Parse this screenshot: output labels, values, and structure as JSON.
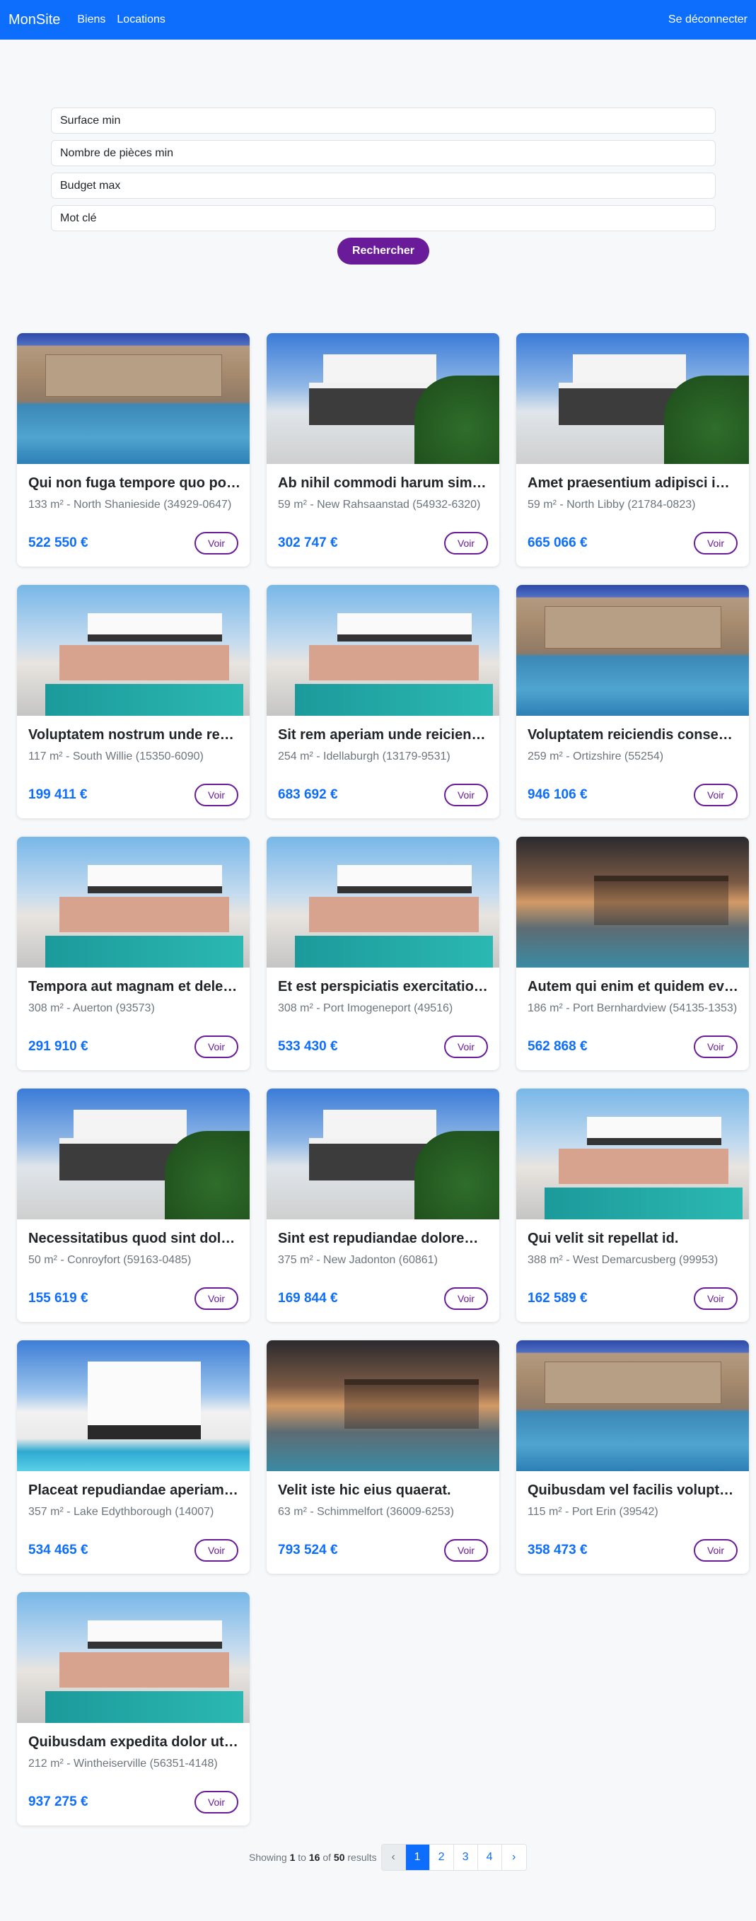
{
  "nav": {
    "brand": "MonSite",
    "links": [
      "Biens",
      "Locations"
    ],
    "logout": "Se déconnecter"
  },
  "search": {
    "surface_placeholder": "Surface min",
    "rooms_placeholder": "Nombre de pièces min",
    "budget_placeholder": "Budget max",
    "keyword_placeholder": "Mot clé",
    "button": "Rechercher"
  },
  "listings": [
    {
      "title": "Qui non fuga tempore quo possimus",
      "subtitle": "133 m² - North Shanieside (34929-0647)",
      "price": "522 550 €",
      "image": "pool-stone-house"
    },
    {
      "title": "Ab nihil commodi harum similique",
      "subtitle": "59 m² - New Rahsaanstad (54932-6320)",
      "price": "302 747 €",
      "image": "modern-white-villa"
    },
    {
      "title": "Amet praesentium adipisci impedit",
      "subtitle": "59 m² - North Libby (21784-0823)",
      "price": "665 066 €",
      "image": "modern-white-villa"
    },
    {
      "title": "Voluptatem nostrum unde repellat",
      "subtitle": "117 m² - South Willie (15350-6090)",
      "price": "199 411 €",
      "image": "pink-villa-pool"
    },
    {
      "title": "Sit rem aperiam unde reiciendis",
      "subtitle": "254 m² - Idellaburgh (13179-9531)",
      "price": "683 692 €",
      "image": "pink-villa-pool"
    },
    {
      "title": "Voluptatem reiciendis consequatur",
      "subtitle": "259 m² - Ortizshire (55254)",
      "price": "946 106 €",
      "image": "pool-stone-house"
    },
    {
      "title": "Tempora aut magnam et deleniti",
      "subtitle": "308 m² - Auerton (93573)",
      "price": "291 910 €",
      "image": "pink-villa-pool"
    },
    {
      "title": "Et est perspiciatis exercitationem",
      "subtitle": "308 m² - Port Imogeneport (49516)",
      "price": "533 430 €",
      "image": "pink-villa-pool"
    },
    {
      "title": "Autem qui enim et quidem eveniet",
      "subtitle": "186 m² - Port Bernhardview (54135-1353)",
      "price": "562 868 €",
      "image": "dusk-pergola-pool"
    },
    {
      "title": "Necessitatibus quod sint dolorem",
      "subtitle": "50 m² - Conroyfort (59163-0485)",
      "price": "155 619 €",
      "image": "modern-white-villa"
    },
    {
      "title": "Sint est repudiandae dolorem earum",
      "subtitle": "375 m² - New Jadonton (60861)",
      "price": "169 844 €",
      "image": "modern-white-villa"
    },
    {
      "title": "Qui velit sit repellat id.",
      "subtitle": "388 m² - West Demarcusberg (99953)",
      "price": "162 589 €",
      "image": "pink-villa-pool"
    },
    {
      "title": "Placeat repudiandae aperiam quia",
      "subtitle": "357 m² - Lake Edythborough (14007)",
      "price": "534 465 €",
      "image": "white-villa-blue-pool"
    },
    {
      "title": "Velit iste hic eius quaerat.",
      "subtitle": "63 m² - Schimmelfort (36009-6253)",
      "price": "793 524 €",
      "image": "dusk-pergola-pool"
    },
    {
      "title": "Quibusdam vel facilis voluptatem",
      "subtitle": "115 m² - Port Erin (39542)",
      "price": "358 473 €",
      "image": "pool-stone-house"
    },
    {
      "title": "Quibusdam expedita dolor ut aut",
      "subtitle": "212 m² - Wintheiserville (56351-4148)",
      "price": "937 275 €",
      "image": "pink-villa-pool"
    }
  ],
  "card_button": "Voir",
  "pagination": {
    "showing_prefix": "Showing",
    "from": "1",
    "to_word": "to",
    "to": "16",
    "of_word": "of",
    "total": "50",
    "suffix": "results",
    "prev": "‹",
    "pages": [
      "1",
      "2",
      "3",
      "4"
    ],
    "next": "›",
    "active_page": "1"
  },
  "colors": {
    "navbar": "#0d6efd",
    "price": "#0d6efd",
    "accent_button": "#6a1b9a"
  }
}
